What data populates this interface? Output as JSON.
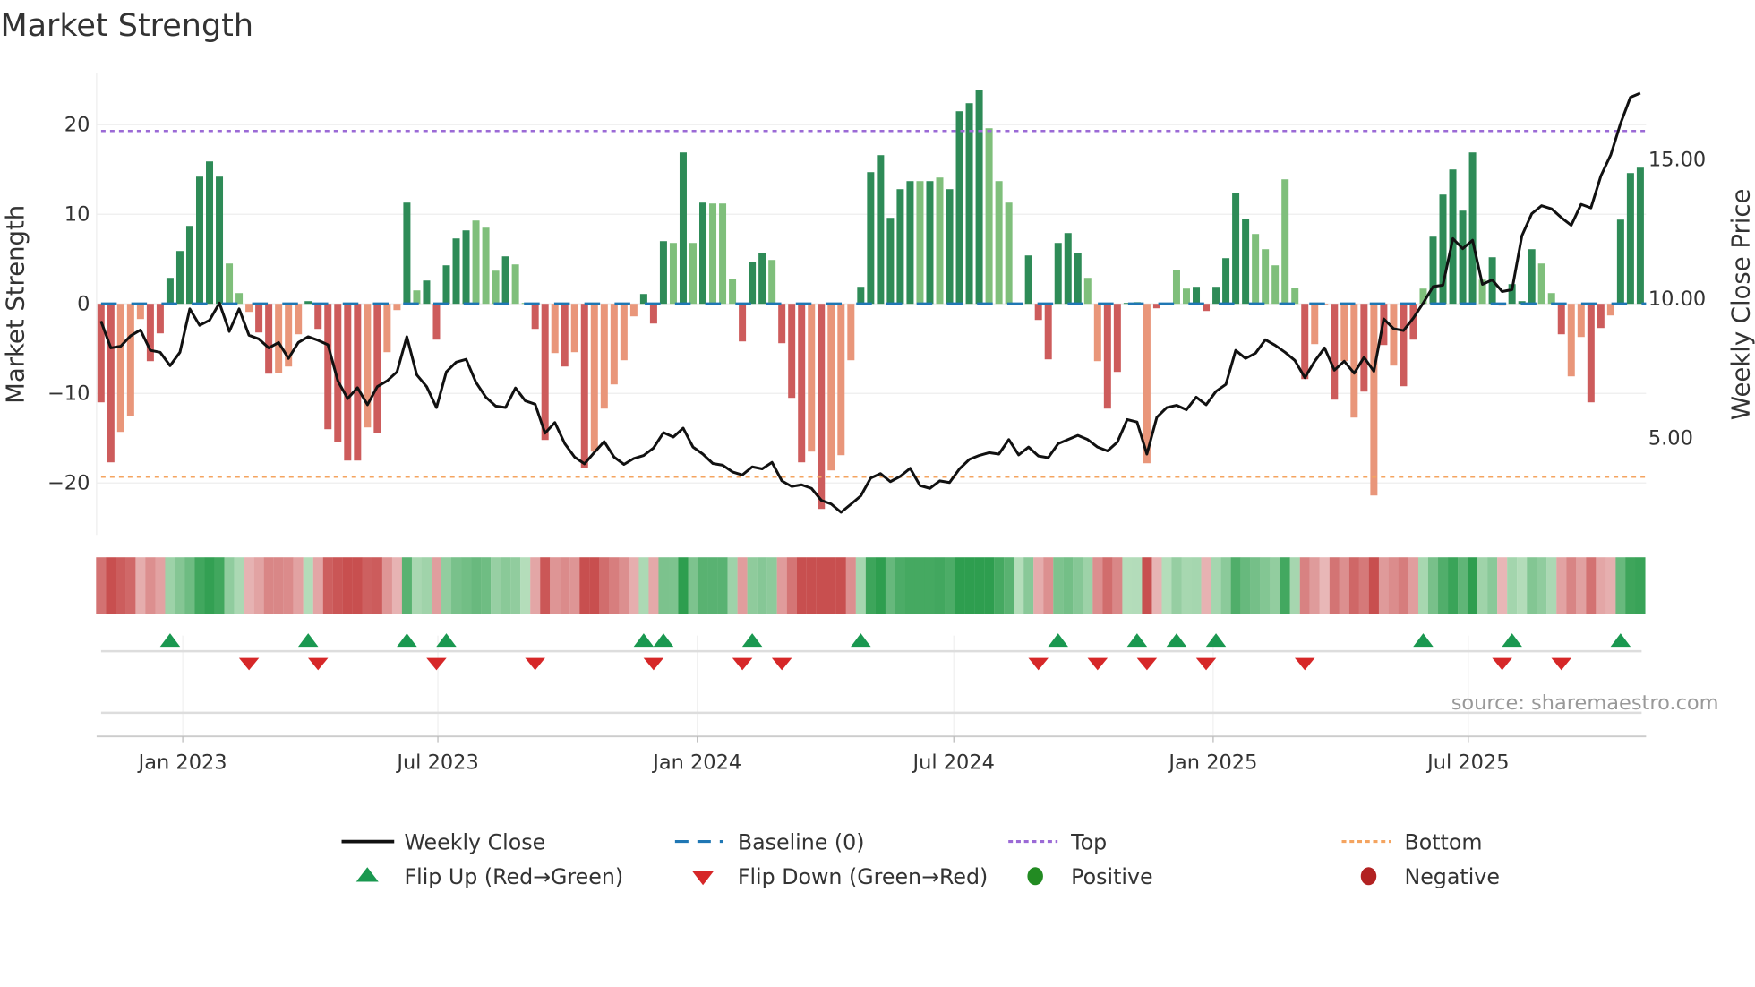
{
  "chart_data": {
    "type": "bar",
    "title": "Market Strength",
    "ylabel": "Market Strength",
    "y2label": "Weekly Close Price",
    "ylim": [
      -25.8,
      25.8
    ],
    "y2lim": [
      1.53,
      18.11
    ],
    "yticks": [
      20,
      10,
      0,
      -10,
      -20
    ],
    "ytick_labels": [
      "20",
      "10",
      "0",
      "−10",
      "−20"
    ],
    "y2ticks": [
      15,
      10,
      5
    ],
    "y2tick_labels": [
      "15.00",
      "10.00",
      "5.00"
    ],
    "xticks": [
      {
        "date": "2023-01-01",
        "label": "Jan 2023"
      },
      {
        "date": "2023-07-01",
        "label": "Jul 2023"
      },
      {
        "date": "2024-01-01",
        "label": "Jan 2024"
      },
      {
        "date": "2024-07-01",
        "label": "Jul 2024"
      },
      {
        "date": "2025-01-01",
        "label": "Jan 2025"
      },
      {
        "date": "2025-07-01",
        "label": "Jul 2025"
      }
    ],
    "x_start": "2022-11-04",
    "x_step_days": 7,
    "top": 19.3,
    "bottom": -19.3,
    "baseline": 0,
    "strength": [
      -11.0,
      -17.7,
      -14.3,
      -12.5,
      -1.7,
      -6.4,
      -3.3,
      2.9,
      5.9,
      8.7,
      14.2,
      15.9,
      14.2,
      4.5,
      1.2,
      -0.9,
      -3.2,
      -7.8,
      -7.7,
      -7.0,
      -3.4,
      0.3,
      -2.8,
      -14.0,
      -15.4,
      -17.5,
      -17.5,
      -13.8,
      -14.4,
      -5.4,
      -0.7,
      11.3,
      1.5,
      2.6,
      -4.0,
      4.3,
      7.3,
      8.2,
      9.3,
      8.5,
      3.7,
      5.3,
      4.4,
      0.1,
      -2.8,
      -15.2,
      -5.5,
      -7.0,
      -5.4,
      -18.3,
      -16.5,
      -11.7,
      -9.0,
      -6.3,
      -1.4,
      1.1,
      -2.2,
      7.0,
      6.8,
      16.9,
      6.8,
      11.3,
      11.2,
      11.2,
      2.8,
      -4.2,
      4.7,
      5.7,
      4.9,
      -4.4,
      -10.5,
      -17.7,
      -16.5,
      -22.9,
      -18.6,
      -16.9,
      -6.3,
      1.9,
      14.7,
      16.6,
      9.6,
      12.8,
      13.7,
      13.7,
      13.7,
      14.1,
      12.8,
      21.5,
      22.4,
      23.9,
      19.6,
      13.7,
      11.3,
      0.1,
      5.4,
      -1.8,
      -6.2,
      6.8,
      7.9,
      5.7,
      2.9,
      -6.4,
      -11.7,
      -7.6,
      0.1,
      0.2,
      -17.8,
      -0.5,
      0.1,
      3.8,
      1.7,
      1.9,
      -0.8,
      1.9,
      5.1,
      12.4,
      9.5,
      7.8,
      6.1,
      4.3,
      13.9,
      1.8,
      -8.4,
      -4.5,
      -0.1,
      -10.7,
      -6.4,
      -12.7,
      -9.8,
      -21.4,
      -4.6,
      -6.9,
      -9.2,
      -4.0,
      1.7,
      7.5,
      12.2,
      15.0,
      10.4,
      16.9,
      2.7,
      5.2,
      -0.2,
      2.2,
      0.3,
      6.1,
      4.5,
      1.2,
      -3.4,
      -8.1,
      -3.7,
      -11.0,
      -2.7,
      -1.3,
      9.4,
      14.6,
      15.2
    ],
    "shade": "ddlllddddddddlllddlllddddddldlldldddddllldllddldldllllldddldldllldddldddldlllddddddldlddddllllddddddlldddllddllddddddllllldlldlldldlddldddddldldddlldllddlddddd",
    "close": [
      9.2,
      8.24,
      8.3,
      8.67,
      8.88,
      8.15,
      8.08,
      7.6,
      8.08,
      9.64,
      9.05,
      9.23,
      9.85,
      8.83,
      9.64,
      8.69,
      8.56,
      8.24,
      8.43,
      7.86,
      8.43,
      8.64,
      8.51,
      8.35,
      7.06,
      6.42,
      6.81,
      6.2,
      6.85,
      7.06,
      7.38,
      8.64,
      7.27,
      6.85,
      6.1,
      7.38,
      7.73,
      7.83,
      7.0,
      6.47,
      6.15,
      6.1,
      6.8,
      6.34,
      6.22,
      5.18,
      5.56,
      4.8,
      4.32,
      4.08,
      4.49,
      4.88,
      4.32,
      4.06,
      4.27,
      4.38,
      4.65,
      5.2,
      5.04,
      5.36,
      4.68,
      4.43,
      4.09,
      4.03,
      3.79,
      3.68,
      3.97,
      3.9,
      4.13,
      3.47,
      3.27,
      3.33,
      3.2,
      2.77,
      2.64,
      2.34,
      2.63,
      2.93,
      3.57,
      3.73,
      3.44,
      3.63,
      3.92,
      3.3,
      3.2,
      3.47,
      3.41,
      3.9,
      4.24,
      4.38,
      4.48,
      4.43,
      4.95,
      4.4,
      4.68,
      4.36,
      4.3,
      4.8,
      4.95,
      5.1,
      4.95,
      4.68,
      4.54,
      4.86,
      5.67,
      5.58,
      4.43,
      5.75,
      6.1,
      6.18,
      6.02,
      6.47,
      6.2,
      6.68,
      6.93,
      8.15,
      7.86,
      8.05,
      8.53,
      8.33,
      8.08,
      7.79,
      7.17,
      7.76,
      8.24,
      7.44,
      7.76,
      7.33,
      7.9,
      7.4,
      9.28,
      8.93,
      8.86,
      9.31,
      9.85,
      10.44,
      10.49,
      12.16,
      11.8,
      12.1,
      10.52,
      10.68,
      10.26,
      10.33,
      12.26,
      13.05,
      13.34,
      13.23,
      12.91,
      12.64,
      13.39,
      13.26,
      14.41,
      15.16,
      16.29,
      17.23,
      17.38
    ],
    "flip_up": [
      7,
      21,
      31,
      35,
      55,
      57,
      66,
      77,
      97,
      105,
      109,
      113,
      134,
      143,
      154
    ],
    "flip_down": [
      15,
      22,
      34,
      44,
      56,
      65,
      69,
      95,
      101,
      106,
      112,
      122,
      142,
      148
    ],
    "legend": {
      "weekly_close": "Weekly Close",
      "baseline": "Baseline (0)",
      "top": "Top",
      "bottom": "Bottom",
      "flip_up": "Flip Up (Red→Green)",
      "flip_down": "Flip Down (Green→Red)",
      "positive": "Positive",
      "negative": "Negative"
    },
    "colors": {
      "pos_dark": "#2e8b57",
      "pos_light": "#7fbf7b",
      "neg_dark": "#cd5c5c",
      "neg_light": "#e9967a",
      "close": "#111111",
      "baseline": "#1f77b4",
      "top": "#9b6ad6",
      "bottom": "#f4a460",
      "flip_up": "#1a9850",
      "flip_down": "#d62728",
      "positive": "#228b22",
      "negative": "#b22222"
    }
  },
  "source": "source: sharemaestro.com"
}
